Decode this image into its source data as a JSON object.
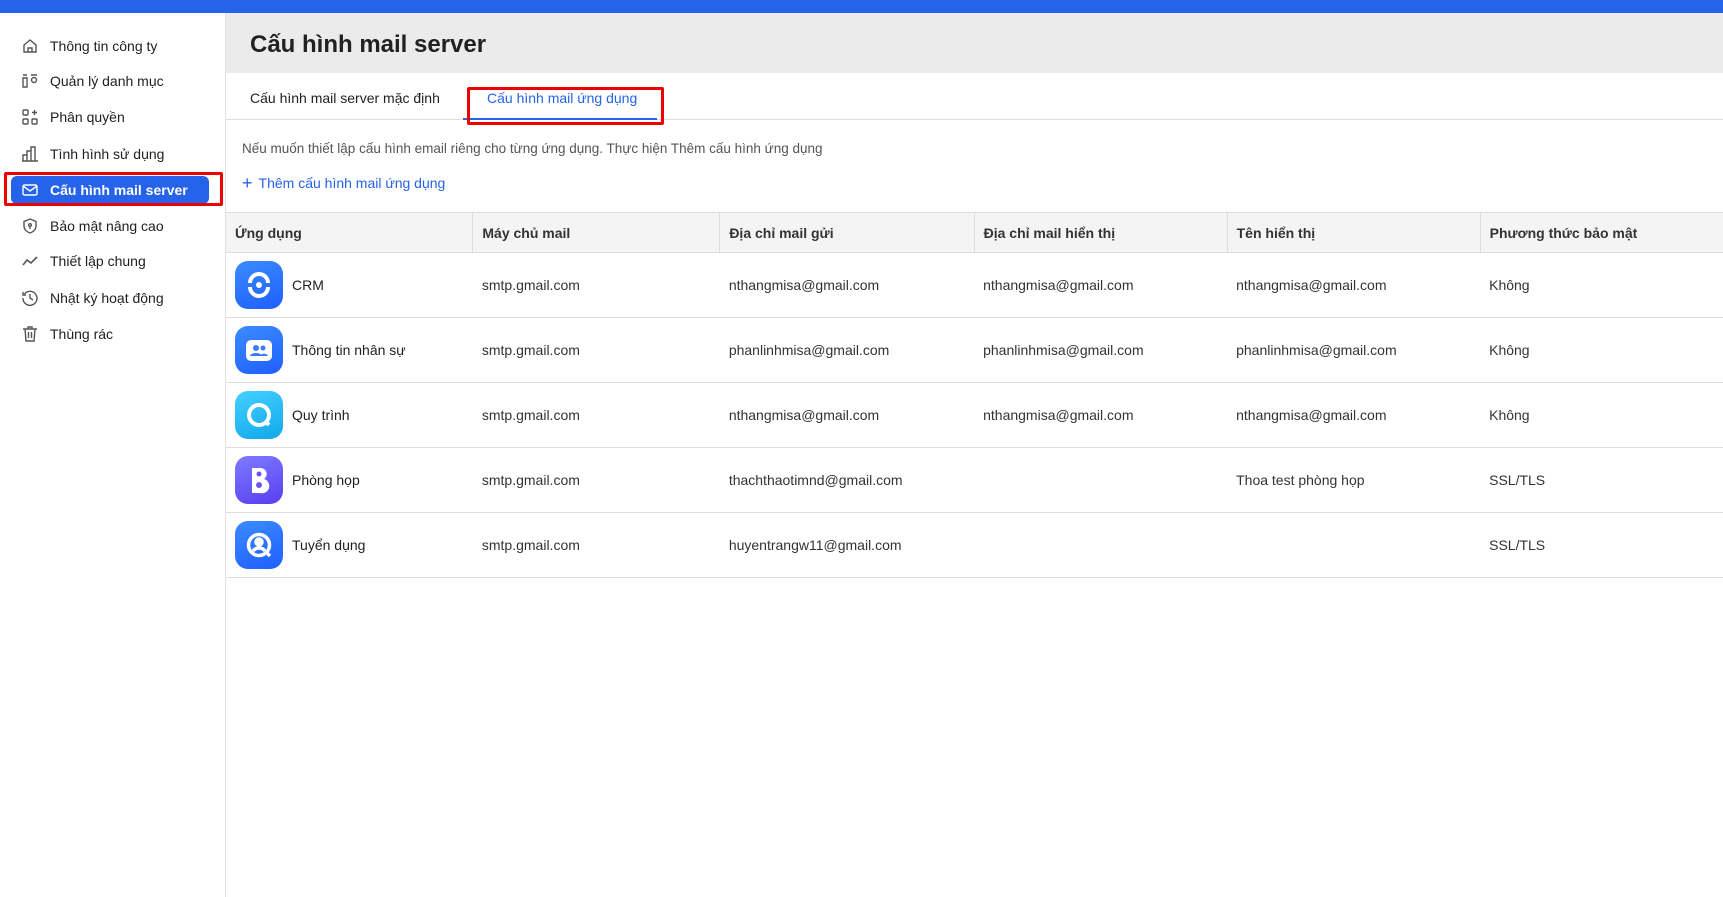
{
  "sidebar": {
    "items": [
      {
        "label": "Thông tin công ty",
        "icon": "home-icon"
      },
      {
        "label": "Quản lý danh mục",
        "icon": "category-icon"
      },
      {
        "label": "Phân quyền",
        "icon": "permission-grid-icon"
      },
      {
        "label": "Tình hình sử dụng",
        "icon": "bar-chart-icon"
      },
      {
        "label": "Cấu hình mail server",
        "icon": "mail-icon",
        "active": true
      },
      {
        "label": "Bảo mật nâng cao",
        "icon": "shield-icon"
      },
      {
        "label": "Thiết lập chung",
        "icon": "trend-icon"
      },
      {
        "label": "Nhật ký hoạt động",
        "icon": "history-icon"
      },
      {
        "label": "Thùng rác",
        "icon": "trash-icon"
      }
    ]
  },
  "header": {
    "title": "Cấu hình mail server"
  },
  "tabs": [
    {
      "label": "Cấu hình mail server mặc định"
    },
    {
      "label": "Cấu hình mail ứng dụng",
      "active": true
    }
  ],
  "description": "Nếu muốn thiết lập cấu hình email riêng cho từng ứng dụng. Thực hiện Thêm cấu hình ứng dụng",
  "add_label": "Thêm cấu hình mail ứng dụng",
  "table": {
    "columns": [
      "Ứng dụng",
      "Máy chủ mail",
      "Địa chỉ mail gửi",
      "Địa chỉ mail hiển thị",
      "Tên hiển thị",
      "Phương thức bảo mật"
    ],
    "rows": [
      {
        "app": "CRM",
        "server": "smtp.gmail.com",
        "from": "nthangmisa@gmail.com",
        "display_mail": "nthangmisa@gmail.com",
        "display_name": "nthangmisa@gmail.com",
        "security": "Không"
      },
      {
        "app": "Thông tin nhân sự",
        "server": "smtp.gmail.com",
        "from": "phanlinhmisa@gmail.com",
        "display_mail": "phanlinhmisa@gmail.com",
        "display_name": "phanlinhmisa@gmail.com",
        "security": "Không"
      },
      {
        "app": "Quy trình",
        "server": "smtp.gmail.com",
        "from": "nthangmisa@gmail.com",
        "display_mail": "nthangmisa@gmail.com",
        "display_name": "nthangmisa@gmail.com",
        "security": "Không"
      },
      {
        "app": "Phòng họp",
        "server": "smtp.gmail.com",
        "from": "thachthaotimnd@gmail.com",
        "display_mail": "",
        "display_name": "Thoa test phòng họp",
        "security": "SSL/TLS"
      },
      {
        "app": "Tuyển dụng",
        "server": "smtp.gmail.com",
        "from": "huyentrangw11@gmail.com",
        "display_mail": "",
        "display_name": "",
        "security": "SSL/TLS"
      }
    ]
  },
  "colors": {
    "accent": "#2563eb",
    "highlight": "#ee0000"
  }
}
